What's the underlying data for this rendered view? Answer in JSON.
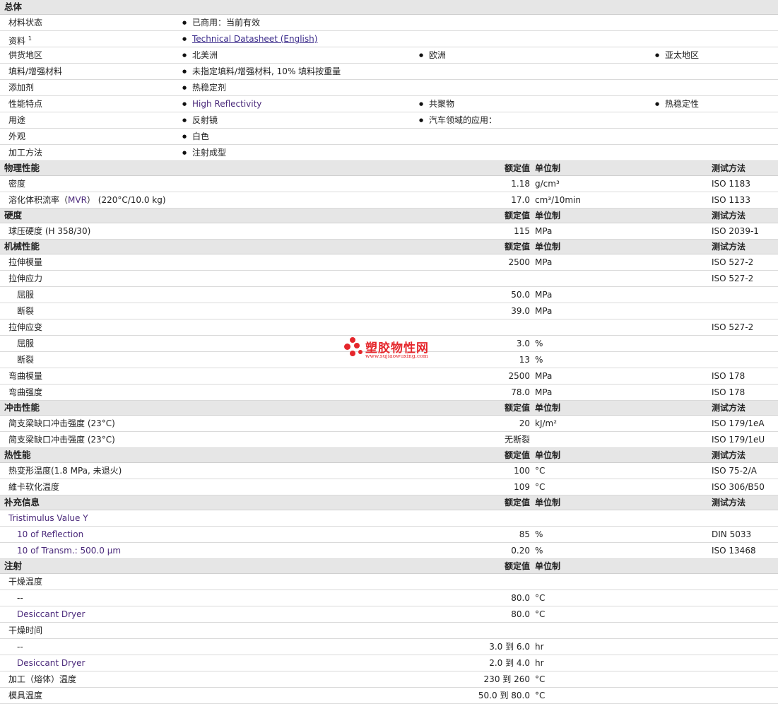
{
  "general": {
    "title": "总体",
    "status_label": "材料状态",
    "status_value": "已商用：当前有效",
    "docs_label": "资料",
    "docs_sup": "1",
    "docs_link": "Technical Datasheet (English)",
    "region_label": "供货地区",
    "regions": [
      "北美洲",
      "欧洲",
      "亚太地区"
    ],
    "filler_label": "填料/增强材料",
    "filler_value": "未指定填料/增强材料, 10% 填料按重量",
    "additive_label": "添加剂",
    "additive_value": "热稳定剂",
    "features_label": "性能特点",
    "features": [
      "High Reflectivity",
      "共聚物",
      "热稳定性"
    ],
    "uses_label": "用途",
    "uses": [
      "反射镜",
      "汽车领域的应用："
    ],
    "appearance_label": "外观",
    "appearance_value": "白色",
    "process_label": "加工方法",
    "process_value": "注射成型"
  },
  "headers": {
    "value": "额定值",
    "unit": "单位制",
    "method": "测试方法"
  },
  "physical": {
    "title": "物理性能",
    "density_label": "密度",
    "density_value": "1.18",
    "density_unit": "g/cm³",
    "density_method": "ISO 1183",
    "mvr_label_a": "溶化体积流率（",
    "mvr_label_b": "MVR",
    "mvr_label_c": "）",
    "mvr_cond": "(220°C/10.0 kg)",
    "mvr_value": "17.0",
    "mvr_unit": "cm³/10min",
    "mvr_method": "ISO 1133"
  },
  "hardness": {
    "title": "硬度",
    "ball_label": "球压硬度",
    "ball_cond": "(H 358/30)",
    "ball_value": "115",
    "ball_unit": "MPa",
    "ball_method": "ISO 2039-1"
  },
  "mechanical": {
    "title": "机械性能",
    "tm_label": "拉伸模量",
    "tm_value": "2500",
    "tm_unit": "MPa",
    "tm_method": "ISO 527-2",
    "ts_label": "拉伸应力",
    "ts_method": "ISO 527-2",
    "ts_yield_label": "屈服",
    "ts_yield_value": "50.0",
    "ts_yield_unit": "MPa",
    "ts_break_label": "断裂",
    "ts_break_value": "39.0",
    "ts_break_unit": "MPa",
    "te_label": "拉伸应变",
    "te_method": "ISO 527-2",
    "te_yield_label": "屈服",
    "te_yield_value": "3.0",
    "te_yield_unit": "%",
    "te_break_label": "断裂",
    "te_break_value": "13",
    "te_break_unit": "%",
    "fm_label": "弯曲模量",
    "fm_value": "2500",
    "fm_unit": "MPa",
    "fm_method": "ISO 178",
    "fs_label": "弯曲强度",
    "fs_value": "78.0",
    "fs_unit": "MPa",
    "fs_method": "ISO 178"
  },
  "impact": {
    "title": "冲击性能",
    "notched_label": "简支梁缺口冲击强度",
    "notched_cond": "(23°C)",
    "notched_value": "20",
    "notched_unit": "kJ/m²",
    "notched_method": "ISO 179/1eA",
    "unnotched_label": "简支梁缺口冲击强度",
    "unnotched_cond": "(23°C)",
    "unnotched_value": "无断裂",
    "unnotched_method": "ISO 179/1eU"
  },
  "thermal": {
    "title": "热性能",
    "hdt_label": "热变形温度",
    "hdt_cond": "(1.8 MPa, 未退火)",
    "hdt_value": "100",
    "hdt_unit": "°C",
    "hdt_method": "ISO 75-2/A",
    "vicat_label": "維卡软化温度",
    "vicat_value": "109",
    "vicat_unit": "°C",
    "vicat_method": "ISO 306/B50"
  },
  "additional": {
    "title": "补充信息",
    "tri_label": "Tristimulus Value Y",
    "refl_label": "10 of Reflection",
    "refl_value": "85",
    "refl_unit": "%",
    "refl_method": "DIN 5033",
    "trans_label": "10 of Transm.: 500.0 µm",
    "trans_value": "0.20",
    "trans_unit": "%",
    "trans_method": "ISO 13468"
  },
  "injection": {
    "title": "注射",
    "dry_temp_label": "干燥温度",
    "dt1_label": "--",
    "dt1_value": "80.0",
    "dt1_unit": "°C",
    "dt2_label": "Desiccant Dryer",
    "dt2_value": "80.0",
    "dt2_unit": "°C",
    "dry_time_label": "干燥时间",
    "dtm1_label": "--",
    "dtm1_value": "3.0 到  6.0",
    "dtm1_unit": "hr",
    "dtm2_label": "Desiccant Dryer",
    "dtm2_value": "2.0 到  4.0",
    "dtm2_unit": "hr",
    "melt_label": "加工（熔体）温度",
    "melt_value": "230 到  260",
    "melt_unit": "°C",
    "mold_label": "模具温度",
    "mold_value": "50.0 到  80.0",
    "mold_unit": "°C"
  },
  "watermark": {
    "name": "塑胶物性网",
    "url": "www.sujiaowuxing.com",
    "color": "#e5262b"
  }
}
